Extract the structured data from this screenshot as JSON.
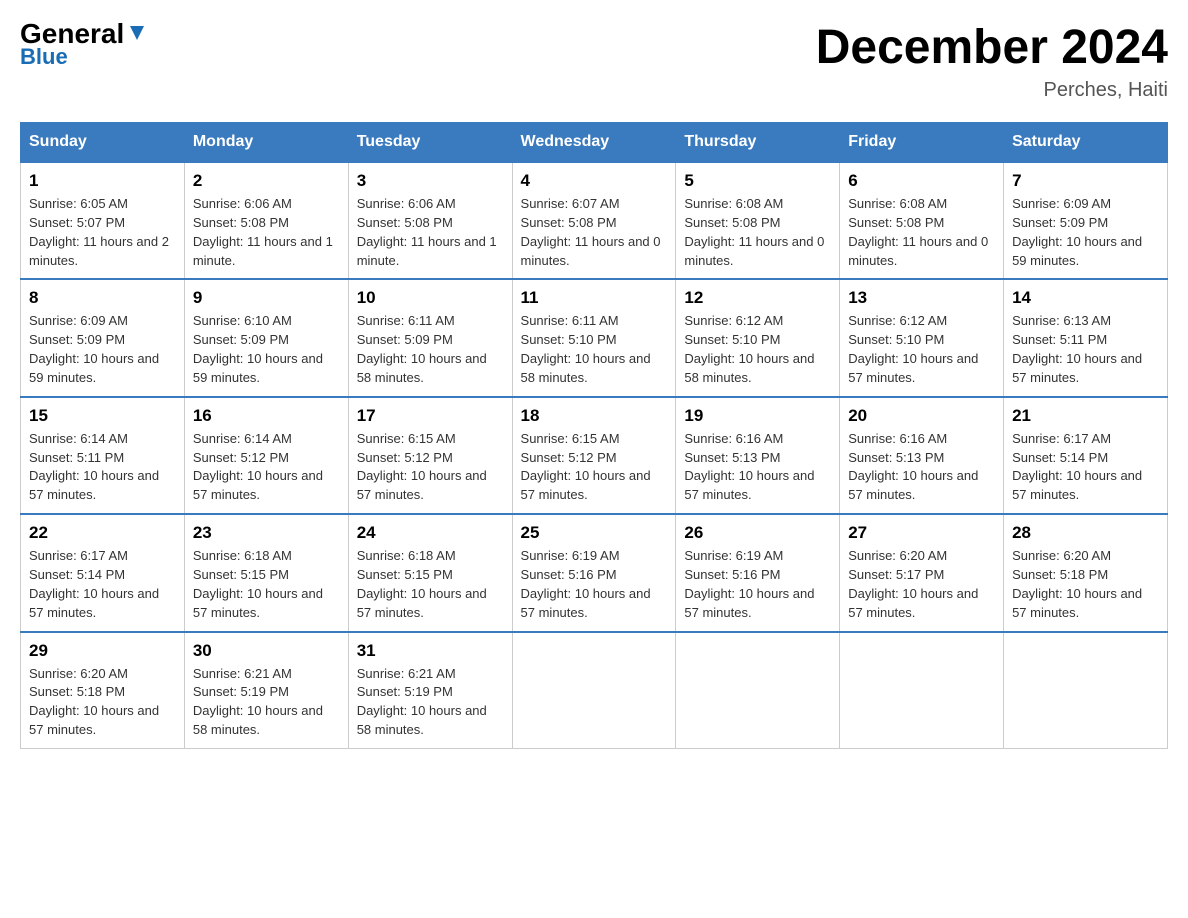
{
  "header": {
    "logo_line1": "General",
    "logo_line2": "Blue",
    "title": "December 2024",
    "subtitle": "Perches, Haiti"
  },
  "weekdays": [
    "Sunday",
    "Monday",
    "Tuesday",
    "Wednesday",
    "Thursday",
    "Friday",
    "Saturday"
  ],
  "weeks": [
    [
      {
        "day": 1,
        "sunrise": "6:05 AM",
        "sunset": "5:07 PM",
        "daylight": "11 hours and 2 minutes."
      },
      {
        "day": 2,
        "sunrise": "6:06 AM",
        "sunset": "5:08 PM",
        "daylight": "11 hours and 1 minute."
      },
      {
        "day": 3,
        "sunrise": "6:06 AM",
        "sunset": "5:08 PM",
        "daylight": "11 hours and 1 minute."
      },
      {
        "day": 4,
        "sunrise": "6:07 AM",
        "sunset": "5:08 PM",
        "daylight": "11 hours and 0 minutes."
      },
      {
        "day": 5,
        "sunrise": "6:08 AM",
        "sunset": "5:08 PM",
        "daylight": "11 hours and 0 minutes."
      },
      {
        "day": 6,
        "sunrise": "6:08 AM",
        "sunset": "5:08 PM",
        "daylight": "11 hours and 0 minutes."
      },
      {
        "day": 7,
        "sunrise": "6:09 AM",
        "sunset": "5:09 PM",
        "daylight": "10 hours and 59 minutes."
      }
    ],
    [
      {
        "day": 8,
        "sunrise": "6:09 AM",
        "sunset": "5:09 PM",
        "daylight": "10 hours and 59 minutes."
      },
      {
        "day": 9,
        "sunrise": "6:10 AM",
        "sunset": "5:09 PM",
        "daylight": "10 hours and 59 minutes."
      },
      {
        "day": 10,
        "sunrise": "6:11 AM",
        "sunset": "5:09 PM",
        "daylight": "10 hours and 58 minutes."
      },
      {
        "day": 11,
        "sunrise": "6:11 AM",
        "sunset": "5:10 PM",
        "daylight": "10 hours and 58 minutes."
      },
      {
        "day": 12,
        "sunrise": "6:12 AM",
        "sunset": "5:10 PM",
        "daylight": "10 hours and 58 minutes."
      },
      {
        "day": 13,
        "sunrise": "6:12 AM",
        "sunset": "5:10 PM",
        "daylight": "10 hours and 57 minutes."
      },
      {
        "day": 14,
        "sunrise": "6:13 AM",
        "sunset": "5:11 PM",
        "daylight": "10 hours and 57 minutes."
      }
    ],
    [
      {
        "day": 15,
        "sunrise": "6:14 AM",
        "sunset": "5:11 PM",
        "daylight": "10 hours and 57 minutes."
      },
      {
        "day": 16,
        "sunrise": "6:14 AM",
        "sunset": "5:12 PM",
        "daylight": "10 hours and 57 minutes."
      },
      {
        "day": 17,
        "sunrise": "6:15 AM",
        "sunset": "5:12 PM",
        "daylight": "10 hours and 57 minutes."
      },
      {
        "day": 18,
        "sunrise": "6:15 AM",
        "sunset": "5:12 PM",
        "daylight": "10 hours and 57 minutes."
      },
      {
        "day": 19,
        "sunrise": "6:16 AM",
        "sunset": "5:13 PM",
        "daylight": "10 hours and 57 minutes."
      },
      {
        "day": 20,
        "sunrise": "6:16 AM",
        "sunset": "5:13 PM",
        "daylight": "10 hours and 57 minutes."
      },
      {
        "day": 21,
        "sunrise": "6:17 AM",
        "sunset": "5:14 PM",
        "daylight": "10 hours and 57 minutes."
      }
    ],
    [
      {
        "day": 22,
        "sunrise": "6:17 AM",
        "sunset": "5:14 PM",
        "daylight": "10 hours and 57 minutes."
      },
      {
        "day": 23,
        "sunrise": "6:18 AM",
        "sunset": "5:15 PM",
        "daylight": "10 hours and 57 minutes."
      },
      {
        "day": 24,
        "sunrise": "6:18 AM",
        "sunset": "5:15 PM",
        "daylight": "10 hours and 57 minutes."
      },
      {
        "day": 25,
        "sunrise": "6:19 AM",
        "sunset": "5:16 PM",
        "daylight": "10 hours and 57 minutes."
      },
      {
        "day": 26,
        "sunrise": "6:19 AM",
        "sunset": "5:16 PM",
        "daylight": "10 hours and 57 minutes."
      },
      {
        "day": 27,
        "sunrise": "6:20 AM",
        "sunset": "5:17 PM",
        "daylight": "10 hours and 57 minutes."
      },
      {
        "day": 28,
        "sunrise": "6:20 AM",
        "sunset": "5:18 PM",
        "daylight": "10 hours and 57 minutes."
      }
    ],
    [
      {
        "day": 29,
        "sunrise": "6:20 AM",
        "sunset": "5:18 PM",
        "daylight": "10 hours and 57 minutes."
      },
      {
        "day": 30,
        "sunrise": "6:21 AM",
        "sunset": "5:19 PM",
        "daylight": "10 hours and 58 minutes."
      },
      {
        "day": 31,
        "sunrise": "6:21 AM",
        "sunset": "5:19 PM",
        "daylight": "10 hours and 58 minutes."
      },
      null,
      null,
      null,
      null
    ]
  ]
}
